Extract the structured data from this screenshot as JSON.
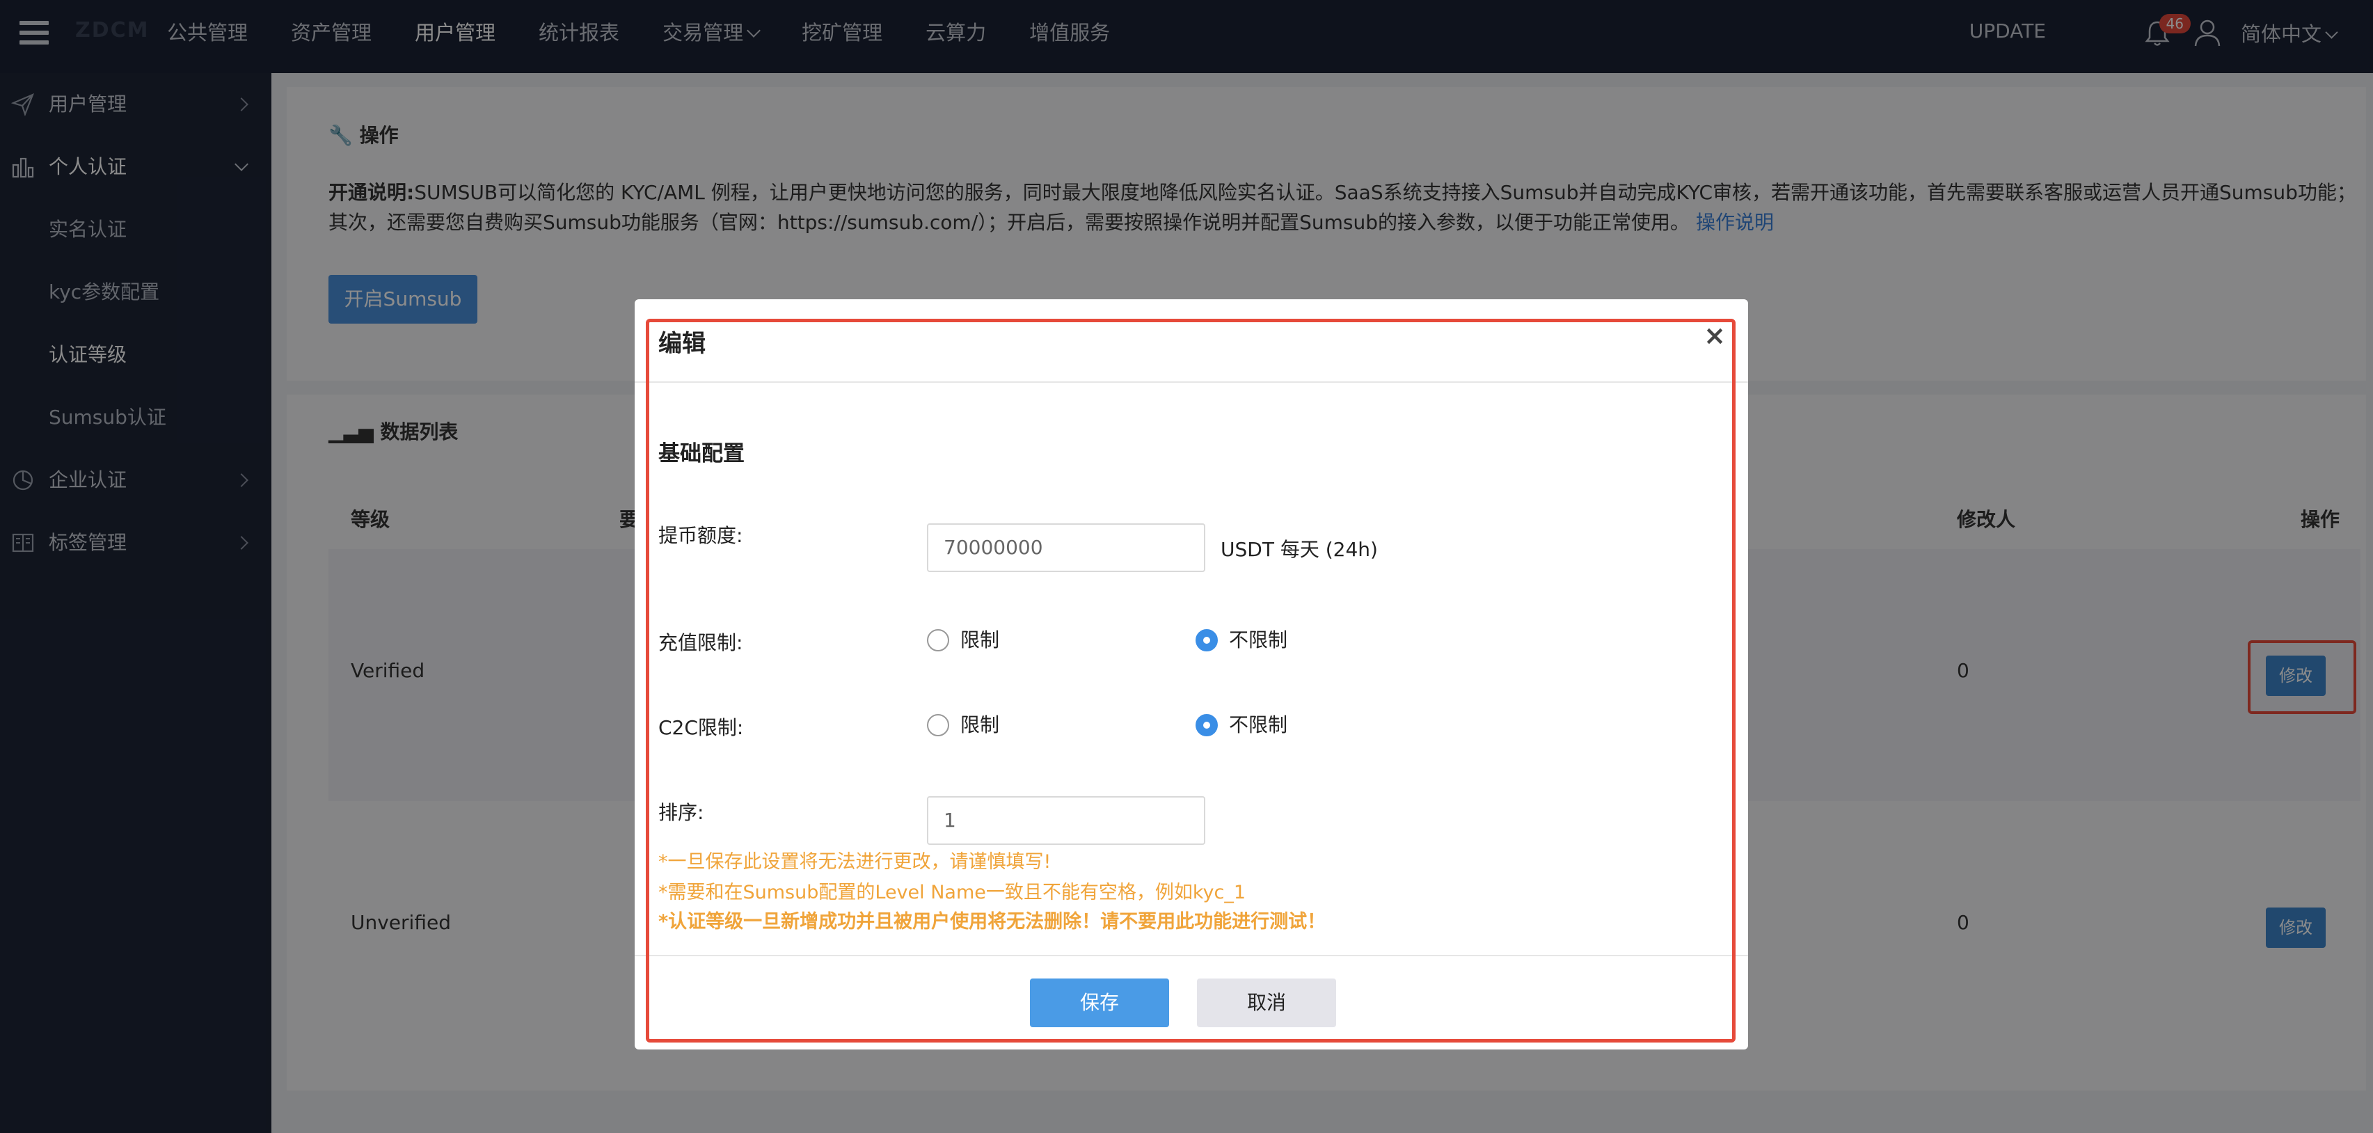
{
  "topbar": {
    "logo": "ZDCM",
    "nav": [
      {
        "label": "公共管理"
      },
      {
        "label": "资产管理"
      },
      {
        "label": "用户管理",
        "active": true
      },
      {
        "label": "统计报表"
      },
      {
        "label": "交易管理"
      },
      {
        "label": "挖矿管理"
      },
      {
        "label": "云算力"
      },
      {
        "label": "增值服务"
      }
    ],
    "update": "UPDATE",
    "notifications": "46",
    "language": "简体中文"
  },
  "sidebar": {
    "items": [
      {
        "label": "用户管理"
      },
      {
        "label": "个人认证"
      },
      {
        "label": "实名认证"
      },
      {
        "label": "kyc参数配置"
      },
      {
        "label": "认证等级"
      },
      {
        "label": "Sumsub认证"
      },
      {
        "label": "企业认证"
      },
      {
        "label": "标签管理"
      }
    ]
  },
  "operation": {
    "title": "操作",
    "desc_bold": "开通说明:",
    "desc_text": "SUMSUB可以简化您的 KYC/AML 例程，让用户更快地访问您的服务，同时最大限度地降低风险实名认证。SaaS系统支持接入Sumsub并自动完成KYC审核，若需开通该功能，首先需要联系客服或运营人员开通Sumsub功能；其次，还需要您自费购买Sumsub功能服务（官网：https://sumsub.com/）；开启后，需要按照操作说明并配置Sumsub的接入参数，以便于功能正常使用。",
    "desc_link": "操作说明",
    "open_button": "开启Sumsub"
  },
  "datalist": {
    "title": "数据列表",
    "headers": {
      "level": "等级",
      "req": "要求",
      "modifier": "修改人",
      "action": "操作"
    },
    "rows": [
      {
        "level": "Verified",
        "modifier": "0",
        "action": "修改"
      },
      {
        "level": "Unverified",
        "modifier": "0",
        "action": "修改"
      }
    ]
  },
  "modal": {
    "title": "编辑",
    "close": "×",
    "section": "基础配置",
    "withdraw_label": "提币额度:",
    "withdraw_value": "70000000",
    "withdraw_unit": "USDT 每天 (24h)",
    "recharge_label": "充值限制:",
    "c2c_label": "C2C限制:",
    "opt_limit": "限制",
    "opt_nolimit": "不限制",
    "sort_label": "排序:",
    "sort_value": "1",
    "notes": [
      "*一旦保存此设置将无法进行更改，请谨慎填写!",
      "*需要和在Sumsub配置的Level Name一致且不能有空格，例如kyc_1",
      "*认证等级一旦新增成功并且被用户使用将无法删除！请不要用此功能进行测试！"
    ],
    "save": "保存",
    "cancel": "取消"
  },
  "colors": {
    "accent": "#4a9be6",
    "warning": "#f0a43a",
    "highlight": "#e64a3a",
    "topbar": "#1b2234"
  }
}
